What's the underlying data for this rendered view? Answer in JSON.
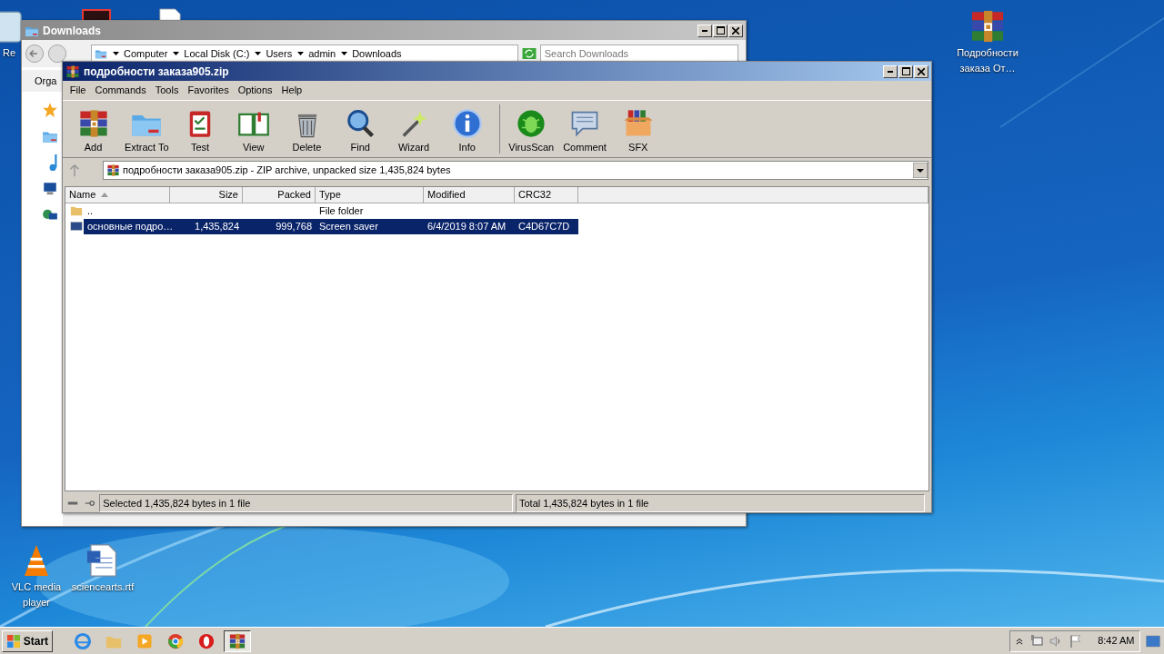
{
  "desktop_icons": [
    {
      "label": "Re"
    },
    {
      "label": "Подробности заказа От…"
    },
    {
      "label": "VLC media player"
    },
    {
      "label": "sciencearts.rtf"
    }
  ],
  "explorer": {
    "title": "Downloads",
    "breadcrumb": [
      "Computer",
      "Local Disk (C:)",
      "Users",
      "admin",
      "Downloads"
    ],
    "search": {
      "placeholder": "Search Downloads"
    },
    "toolbar_text": "Orga"
  },
  "winrar": {
    "title": "подробности заказа905.zip",
    "menu": [
      "File",
      "Commands",
      "Tools",
      "Favorites",
      "Options",
      "Help"
    ],
    "toolbar": [
      {
        "label": "Add"
      },
      {
        "label": "Extract To"
      },
      {
        "label": "Test"
      },
      {
        "label": "View"
      },
      {
        "label": "Delete"
      },
      {
        "label": "Find"
      },
      {
        "label": "Wizard"
      },
      {
        "label": "Info"
      },
      {
        "label": "VirusScan"
      },
      {
        "label": "Comment"
      },
      {
        "label": "SFX"
      }
    ],
    "address": "подробности заказа905.zip - ZIP archive, unpacked size 1,435,824 bytes",
    "table": {
      "columns": [
        {
          "label": "Name",
          "sorted": true
        },
        {
          "label": "Size",
          "sorted": false
        },
        {
          "label": "Packed",
          "sorted": false
        },
        {
          "label": "Type",
          "sorted": false
        },
        {
          "label": "Modified",
          "sorted": false
        },
        {
          "label": "CRC32",
          "sorted": false
        }
      ],
      "rows": [
        {
          "kind": "folder",
          "selected": false,
          "cells": [
            "..",
            "",
            "",
            "File folder",
            "",
            ""
          ]
        },
        {
          "kind": "file",
          "selected": true,
          "cells": [
            "основные подро…",
            "1,435,824",
            "999,768",
            "Screen saver",
            "6/4/2019 8:07 AM",
            "C4D67C7D"
          ]
        }
      ]
    },
    "status_bar": [
      "Selected 1,435,824 bytes in 1 file",
      "Total 1,435,824 bytes in 1 file"
    ]
  },
  "taskbar": {
    "start": "Start",
    "apps": [
      {
        "selected": false
      },
      {
        "selected": false
      },
      {
        "selected": false
      },
      {
        "selected": false
      },
      {
        "selected": false
      },
      {
        "selected": true
      }
    ],
    "clock": "8:42 AM"
  }
}
